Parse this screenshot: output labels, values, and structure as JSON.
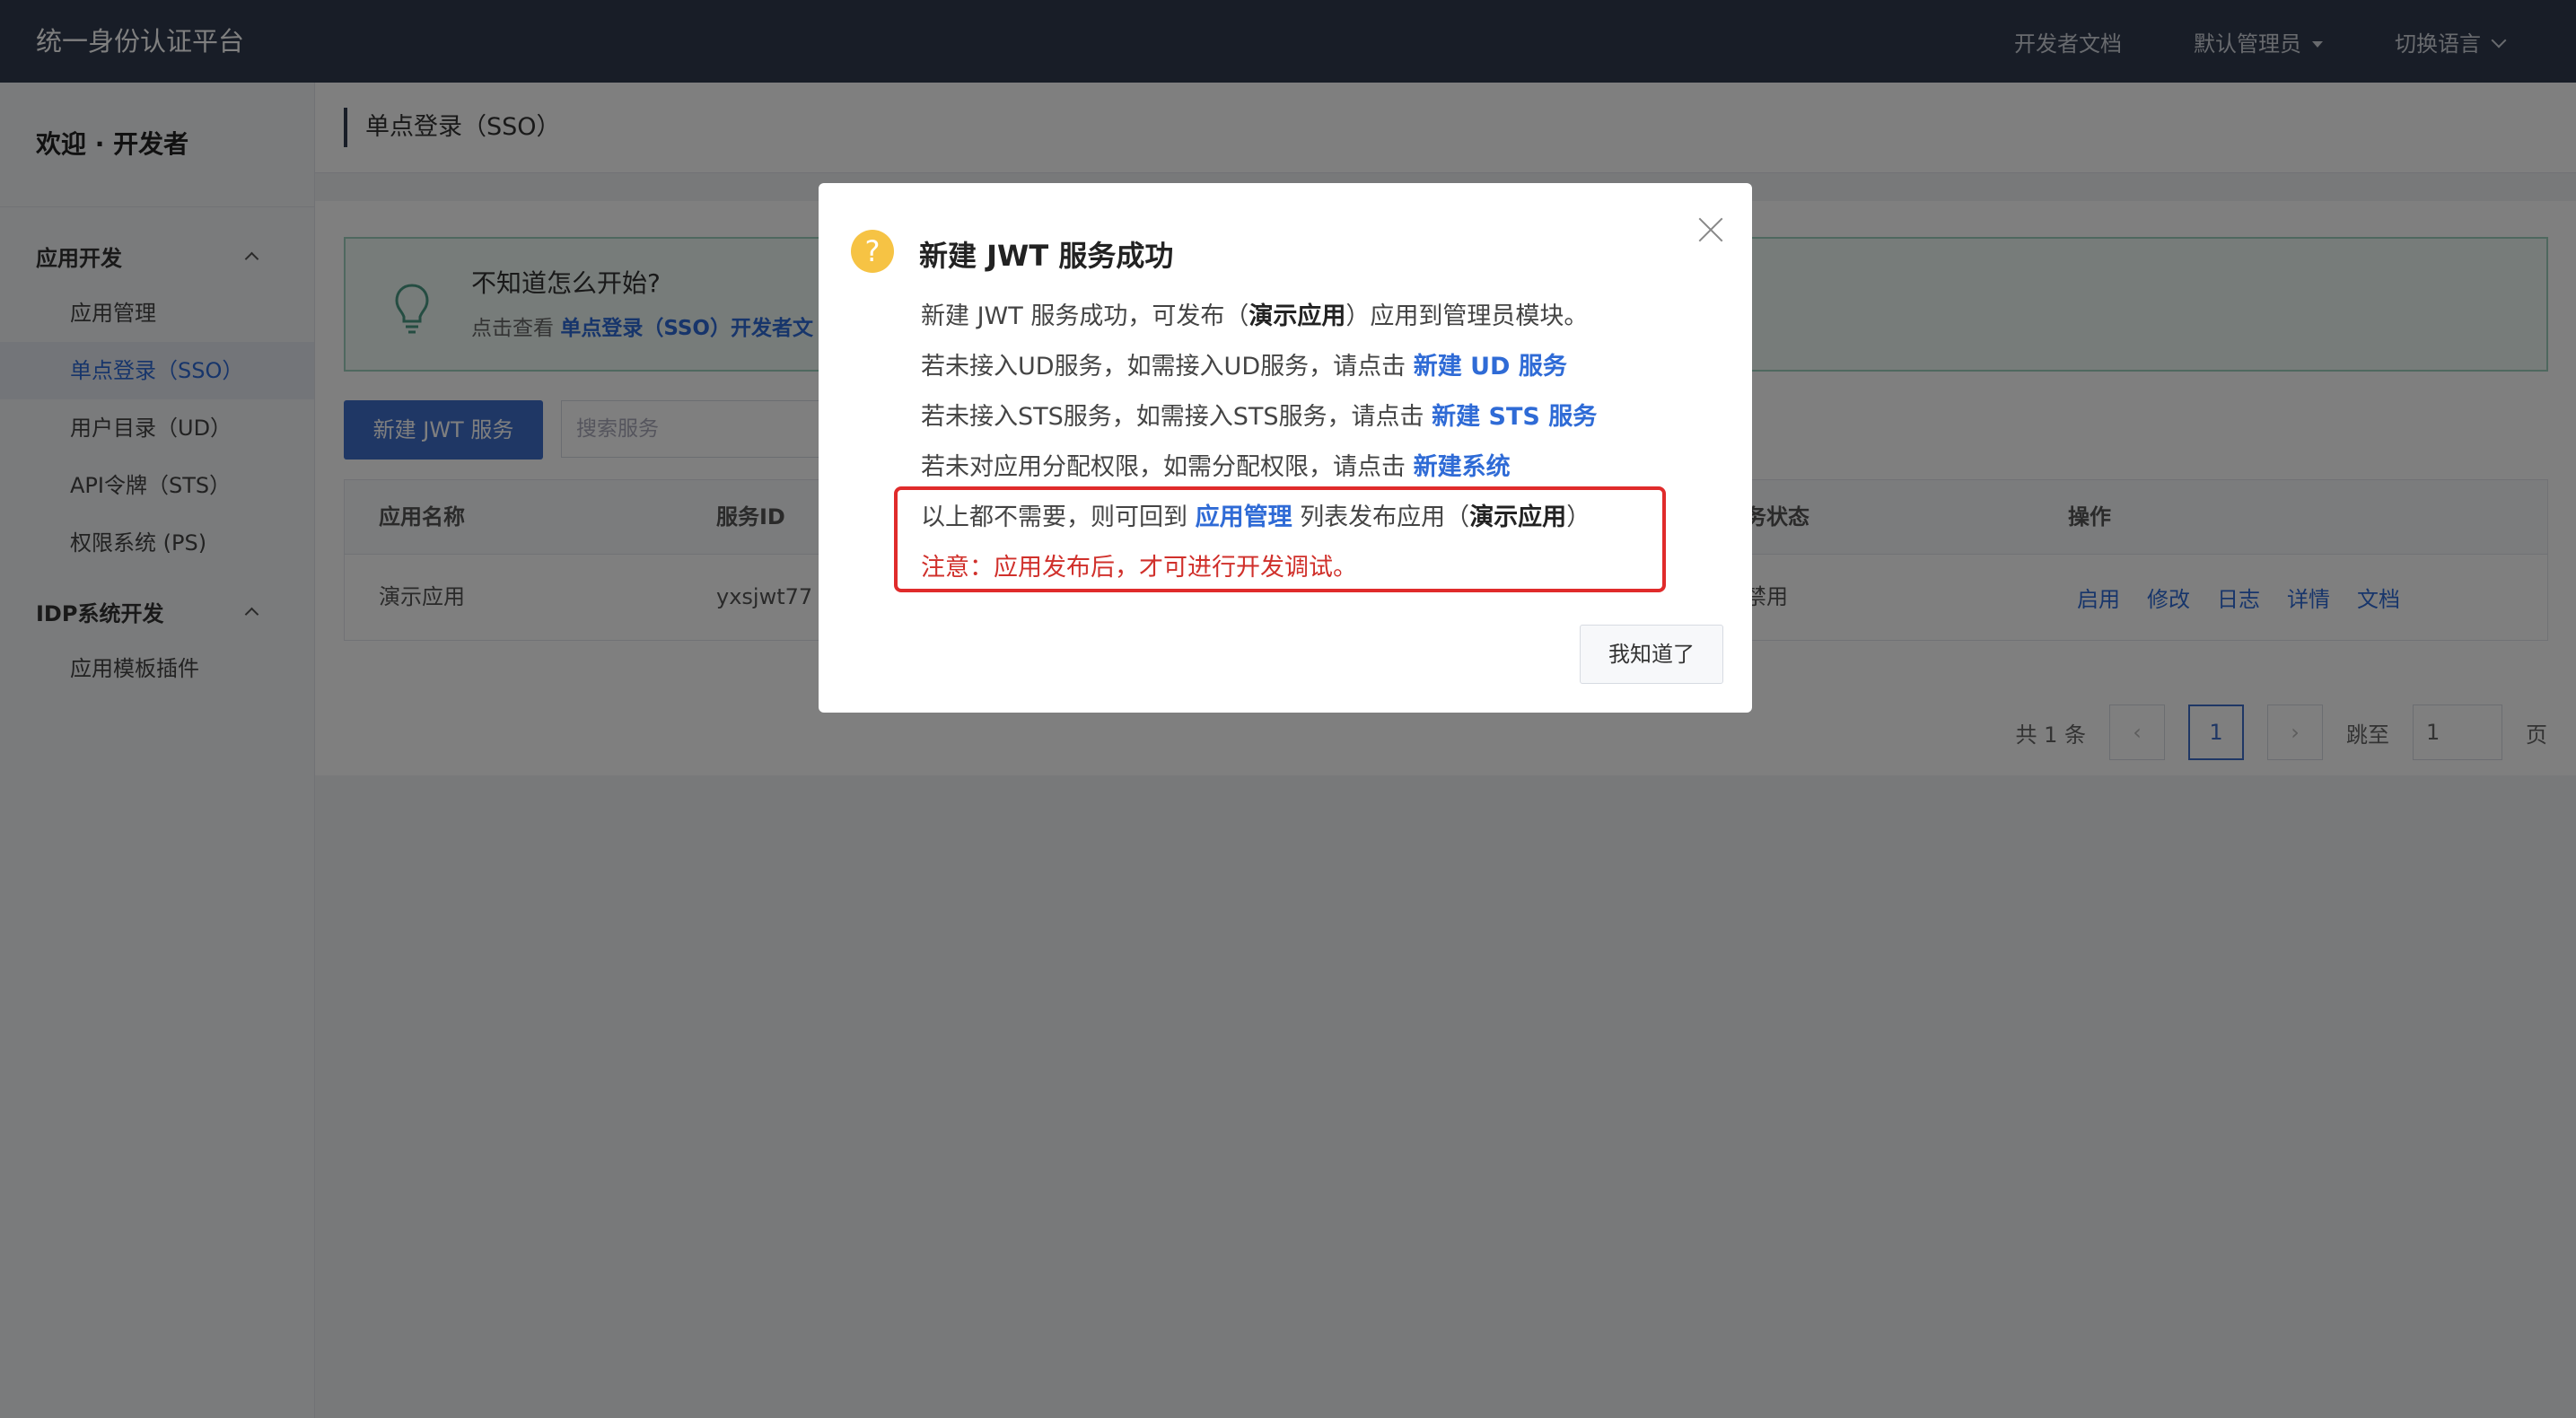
{
  "topbar": {
    "brand": "统一身份认证平台",
    "dev_docs": "开发者文档",
    "admin": "默认管理员",
    "language": "切换语言"
  },
  "sidebar": {
    "welcome": "欢迎 · 开发者",
    "groups": [
      {
        "label": "应用开发",
        "items": [
          "应用管理",
          "单点登录（SSO）",
          "用户目录（UD）",
          "API令牌（STS）",
          "权限系统 (PS)"
        ]
      },
      {
        "label": "IDP系统开发",
        "items": [
          "应用模板插件"
        ]
      }
    ]
  },
  "page": {
    "breadcrumb": "单点登录（SSO）",
    "tip_question": "不知道怎么开始?",
    "tip_prefix": "点击查看",
    "tip_link": "单点登录（SSO）开发者文",
    "new_button": "新建 JWT 服务",
    "search_placeholder": "搜索服务"
  },
  "table": {
    "headers": [
      "应用名称",
      "服务ID",
      "务状态",
      "操作"
    ],
    "row": {
      "name": "演示应用",
      "service_id": "yxsjwt77",
      "status": "禁用"
    },
    "ops": [
      "启用",
      "修改",
      "日志",
      "详情",
      "文档"
    ]
  },
  "pager": {
    "total": "共 1 条",
    "current": "1",
    "jump_label": "跳至",
    "jump_value": "1",
    "page_unit": "页"
  },
  "modal": {
    "title": "新建 JWT 服务成功",
    "l1_a": "新建 JWT 服务成功，可发布（",
    "l1_b": "演示应用",
    "l1_c": "）应用到管理员模块。",
    "l2_a": "若未接入UD服务，如需接入UD服务，请点击",
    "l2_link": "新建 UD 服务",
    "l3_a": "若未接入STS服务，如需接入STS服务，请点击",
    "l3_link": "新建 STS 服务",
    "l4_a": "若未对应用分配权限，如需分配权限，请点击",
    "l4_link": "新建系统",
    "l5_a": "以上都不需要，则可回到",
    "l5_link": "应用管理",
    "l5_b": "列表发布应用（",
    "l5_c": "演示应用",
    "l5_d": "）",
    "l6": "注意：应用发布后，才可进行开发调试。",
    "ok": "我知道了"
  },
  "colors": {
    "accent": "#3f6ecb",
    "link": "#2f6bd6",
    "warn": "#d0302b",
    "topbar": "#313b4f"
  }
}
